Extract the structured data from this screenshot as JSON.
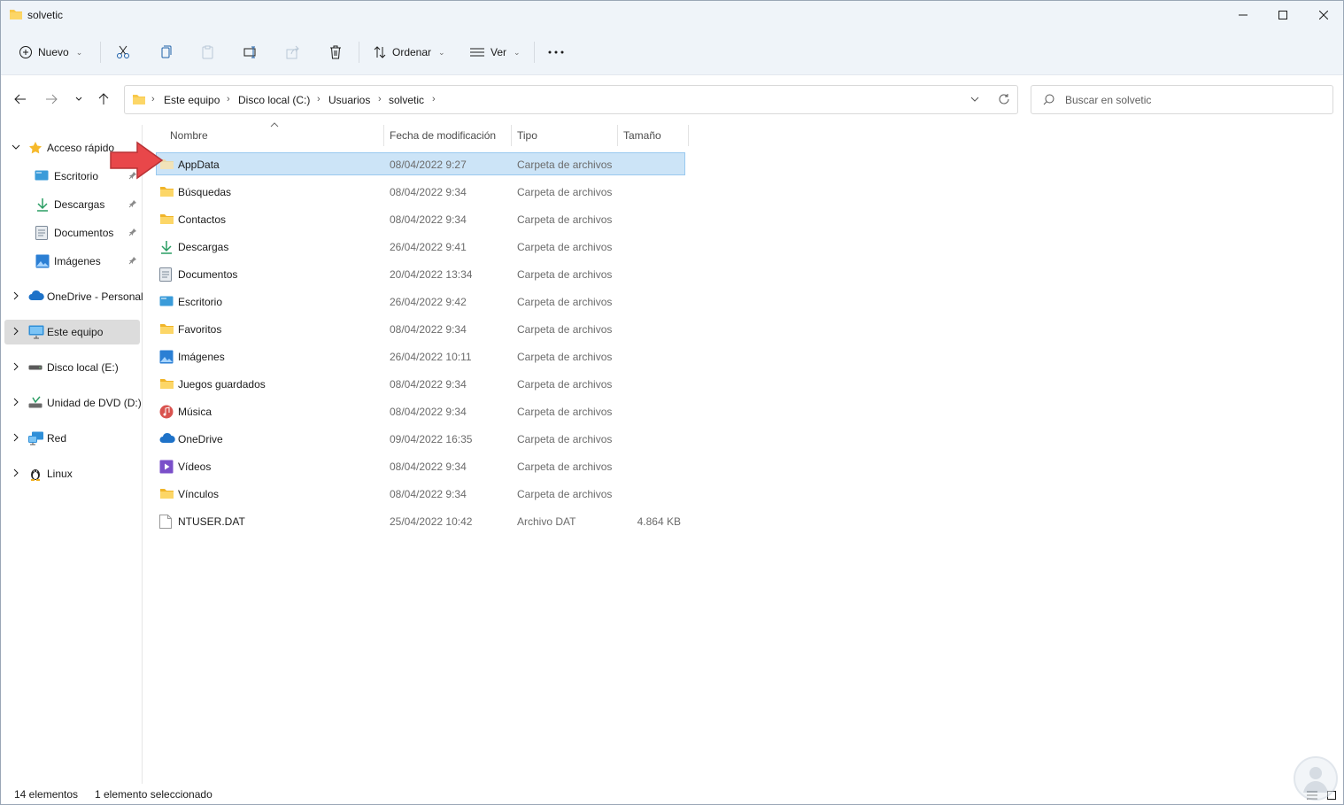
{
  "window": {
    "title": "solvetic",
    "controls": [
      "minimize-icon",
      "maximize-icon",
      "close-icon"
    ]
  },
  "commandbar": {
    "new_label": "Nuevo",
    "sort_label": "Ordenar",
    "view_label": "Ver",
    "icons": [
      "cut-icon",
      "copy-icon",
      "paste-icon",
      "rename-icon",
      "share-icon",
      "delete-icon",
      "more-icon"
    ]
  },
  "addressbar": {
    "breadcrumbs": [
      "Este equipo",
      "Disco local (C:)",
      "Usuarios",
      "solvetic"
    ]
  },
  "search": {
    "placeholder": "Buscar en solvetic"
  },
  "sidebar": {
    "items": [
      {
        "label": "Acceso rápido",
        "icon": "star-icon"
      },
      {
        "label": "Escritorio",
        "icon": "desktop-icon"
      },
      {
        "label": "Descargas",
        "icon": "download-icon"
      },
      {
        "label": "Documentos",
        "icon": "document-icon"
      },
      {
        "label": "Imágenes",
        "icon": "pictures-icon"
      },
      {
        "label": "OneDrive - Personal",
        "icon": "cloud-icon"
      },
      {
        "label": "Este equipo",
        "icon": "computer-icon"
      },
      {
        "label": "Disco local (E:)",
        "icon": "drive-icon"
      },
      {
        "label": "Unidad de DVD (D:)",
        "icon": "dvd-icon"
      },
      {
        "label": "Red",
        "icon": "network-icon"
      },
      {
        "label": "Linux",
        "icon": "linux-icon"
      }
    ]
  },
  "filelist": {
    "columns": [
      "Nombre",
      "Fecha de modificación",
      "Tipo",
      "Tamaño"
    ],
    "rows": [
      {
        "name": "AppData",
        "date": "08/04/2022 9:27",
        "type": "Carpeta de archivos",
        "size": "",
        "icon": "folder-icon"
      },
      {
        "name": "Búsquedas",
        "date": "08/04/2022 9:34",
        "type": "Carpeta de archivos",
        "size": "",
        "icon": "folder-icon"
      },
      {
        "name": "Contactos",
        "date": "08/04/2022 9:34",
        "type": "Carpeta de archivos",
        "size": "",
        "icon": "folder-icon"
      },
      {
        "name": "Descargas",
        "date": "26/04/2022 9:41",
        "type": "Carpeta de archivos",
        "size": "",
        "icon": "download-icon"
      },
      {
        "name": "Documentos",
        "date": "20/04/2022 13:34",
        "type": "Carpeta de archivos",
        "size": "",
        "icon": "document-icon"
      },
      {
        "name": "Escritorio",
        "date": "26/04/2022 9:42",
        "type": "Carpeta de archivos",
        "size": "",
        "icon": "desktop-icon"
      },
      {
        "name": "Favoritos",
        "date": "08/04/2022 9:34",
        "type": "Carpeta de archivos",
        "size": "",
        "icon": "folder-icon"
      },
      {
        "name": "Imágenes",
        "date": "26/04/2022 10:11",
        "type": "Carpeta de archivos",
        "size": "",
        "icon": "pictures-icon"
      },
      {
        "name": "Juegos guardados",
        "date": "08/04/2022 9:34",
        "type": "Carpeta de archivos",
        "size": "",
        "icon": "folder-icon"
      },
      {
        "name": "Música",
        "date": "08/04/2022 9:34",
        "type": "Carpeta de archivos",
        "size": "",
        "icon": "music-icon"
      },
      {
        "name": "OneDrive",
        "date": "09/04/2022 16:35",
        "type": "Carpeta de archivos",
        "size": "",
        "icon": "cloud-icon"
      },
      {
        "name": "Vídeos",
        "date": "08/04/2022 9:34",
        "type": "Carpeta de archivos",
        "size": "",
        "icon": "video-icon"
      },
      {
        "name": "Vínculos",
        "date": "08/04/2022 9:34",
        "type": "Carpeta de archivos",
        "size": "",
        "icon": "folder-icon"
      },
      {
        "name": "NTUSER.DAT",
        "date": "25/04/2022 10:42",
        "type": "Archivo DAT",
        "size": "4.864 KB",
        "icon": "file-icon"
      }
    ]
  },
  "statusbar": {
    "count": "14 elementos",
    "selection": "1 elemento seleccionado"
  },
  "colors": {
    "chrome": "#eff4f9",
    "selection": "#cce4f7",
    "selection_border": "#99c9ef",
    "folder": "#f8c84a",
    "annotation_arrow": "#e8474a"
  }
}
